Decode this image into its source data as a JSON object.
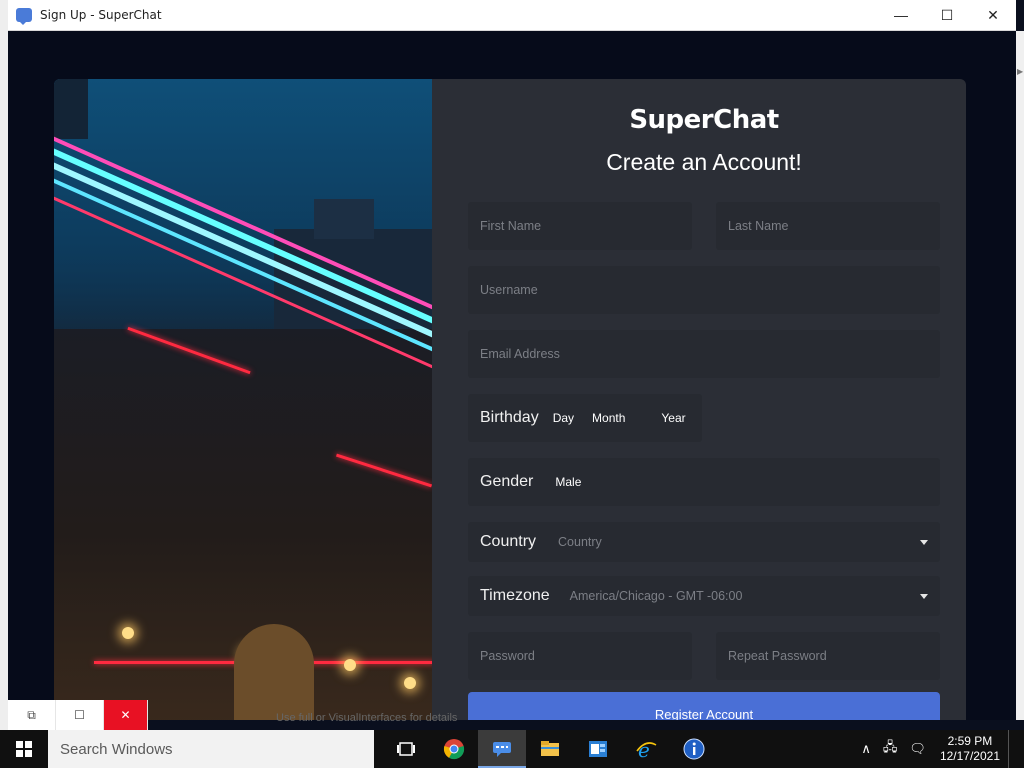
{
  "window": {
    "title": "Sign Up - SuperChat",
    "minimize": "—",
    "maximize": "☐",
    "close": "✕"
  },
  "form": {
    "brand": "SuperChat",
    "heading": "Create an Account!",
    "first_name_placeholder": "First Name",
    "last_name_placeholder": "Last Name",
    "username_placeholder": "Username",
    "email_placeholder": "Email Address",
    "birthday_label": "Birthday",
    "birthday_day": "Day",
    "birthday_month": "Month",
    "birthday_year": "Year",
    "gender_label": "Gender",
    "gender_value": "Male",
    "country_label": "Country",
    "country_placeholder": "Country",
    "timezone_label": "Timezone",
    "timezone_value": "America/Chicago - GMT -06:00",
    "password_placeholder": "Password",
    "repeat_password_placeholder": "Repeat Password",
    "register_label": "Register Account"
  },
  "mini_controls": {
    "restore": "⧉",
    "blank": "☐",
    "close": "✕"
  },
  "background_text": "Use full or VisualInterfaces for details",
  "taskbar": {
    "search_placeholder": "Search Windows",
    "icons": [
      "task-view-icon",
      "chrome-icon",
      "superchat-icon",
      "file-explorer-icon",
      "outlook-icon",
      "internet-explorer-icon",
      "info-icon"
    ],
    "time": "2:59 PM",
    "date": "12/17/2021"
  },
  "colors": {
    "panel": "#2b2e36",
    "field": "#272a31",
    "accent": "#4a6fd6",
    "taskbar": "#101010"
  }
}
